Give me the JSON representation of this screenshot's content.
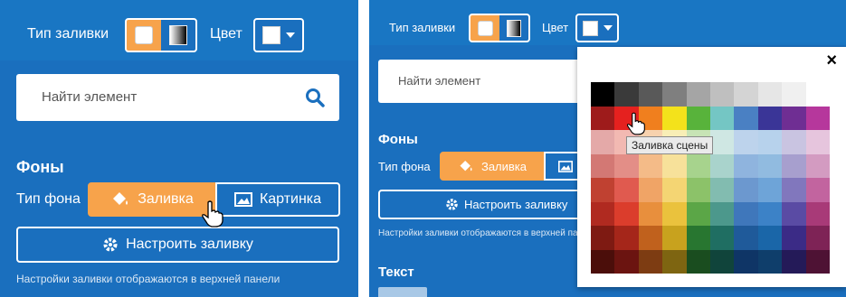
{
  "left": {
    "fill_type_label": "Тип заливки",
    "color_label": "Цвет",
    "search_placeholder": "Найти элемент",
    "backgrounds_heading": "Фоны",
    "bg_type_label": "Тип фона",
    "fill_button": "Заливка",
    "picture_button": "Картинка",
    "configure_button": "Настроить заливку",
    "note": "Настройки заливки отображаются в верхней панели"
  },
  "right": {
    "fill_type_label": "Тип заливки",
    "color_label": "Цвет",
    "search_placeholder": "Найти элемент",
    "backgrounds_heading": "Фоны",
    "bg_type_label": "Тип фона",
    "fill_button": "Заливка",
    "configure_button": "Настроить заливку",
    "note": "Настройки заливки отображаются в верхней панели",
    "text_heading": "Текст"
  },
  "popup": {
    "close": "×",
    "tooltip": "Заливка сцены",
    "palette": [
      [
        "#000000",
        "#3a3a3a",
        "#595959",
        "#7f7f7f",
        "#a5a5a5",
        "#bfbfbf",
        "#d4d4d4",
        "#e6e6e6",
        "#f0f0f0",
        "#ffffff"
      ],
      [
        "#9e1b1b",
        "#e5211f",
        "#f07f1e",
        "#f3e21b",
        "#58b33b",
        "#74c6c4",
        "#4a80c3",
        "#3a3597",
        "#6f2e93",
        "#b6379c"
      ],
      [
        "#e4a9a8",
        "#f2b9b2",
        "#f7d2ae",
        "#f8eeb6",
        "#c7e3b5",
        "#cfe7e3",
        "#bdd3ec",
        "#b7d2ec",
        "#c9c4e1",
        "#e6c5dd"
      ],
      [
        "#d37874",
        "#e38e87",
        "#f4bb88",
        "#f7e19a",
        "#a7d38d",
        "#a9d3cc",
        "#8fb4de",
        "#91bbe0",
        "#a79fce",
        "#d39bc1"
      ],
      [
        "#c04131",
        "#e05a4f",
        "#f0a466",
        "#f4d573",
        "#8cc269",
        "#82bcb0",
        "#6c98cf",
        "#6ea4d8",
        "#8177bd",
        "#c2649f"
      ],
      [
        "#b02a20",
        "#db3d2c",
        "#e88f3d",
        "#eac23d",
        "#5ba647",
        "#4c988c",
        "#3f77bb",
        "#3c82c7",
        "#5a4ba4",
        "#a83a78"
      ],
      [
        "#7e1a12",
        "#a5261a",
        "#c0611d",
        "#c8a21e",
        "#287630",
        "#1f6e62",
        "#1f5a9a",
        "#1a66a8",
        "#3b2b86",
        "#7e2356"
      ],
      [
        "#4b0e0a",
        "#6b1410",
        "#7d3c12",
        "#7e6511",
        "#1a4d1f",
        "#10443b",
        "#0f3566",
        "#0f3e6b",
        "#241a58",
        "#4e1234"
      ]
    ]
  }
}
